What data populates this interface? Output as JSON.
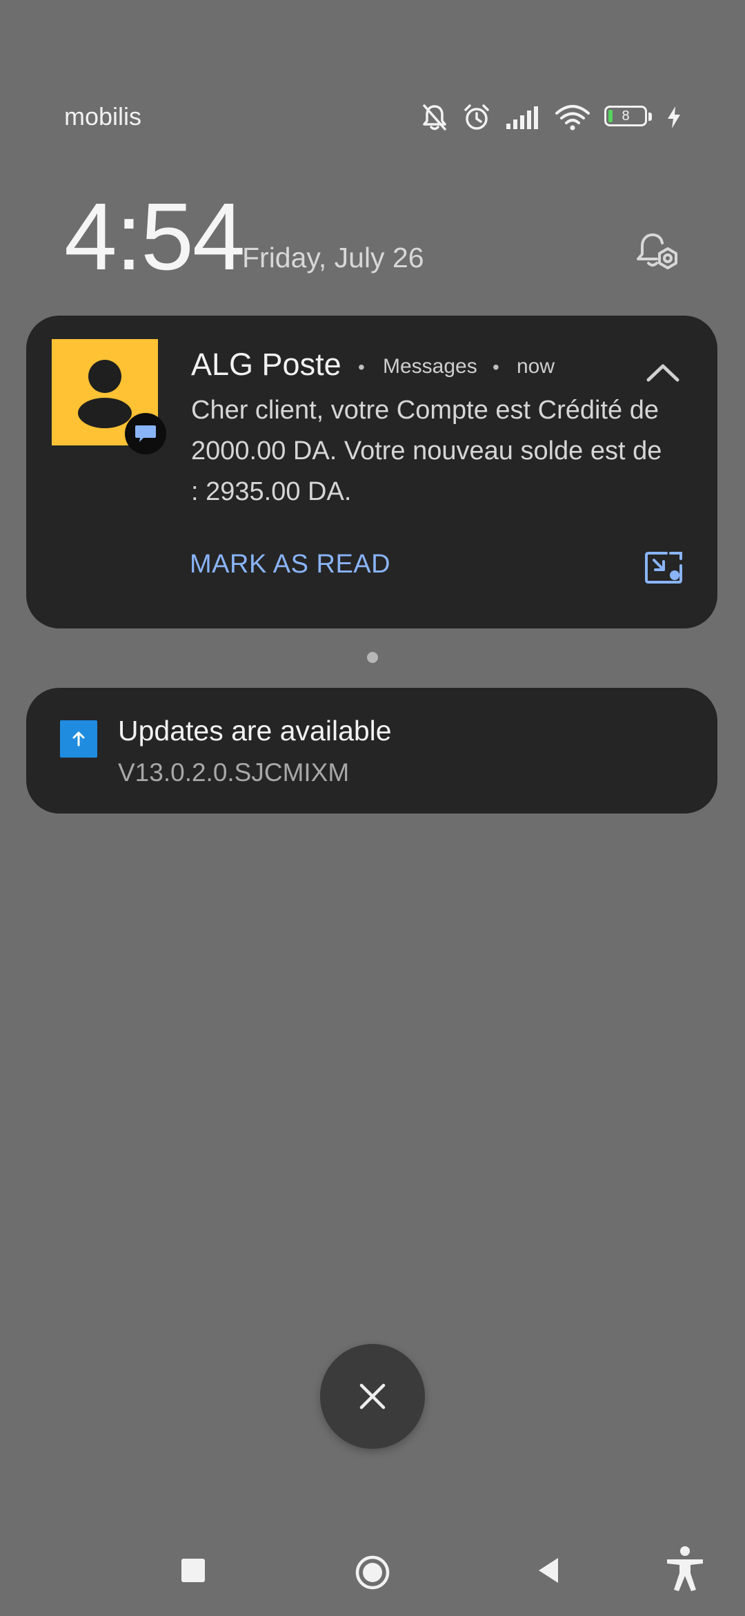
{
  "status_bar": {
    "carrier": "mobilis",
    "battery_level": "8",
    "icons": [
      "bell-muted-icon",
      "alarm-icon",
      "signal-icon",
      "wifi-icon",
      "battery-icon",
      "charging-bolt-icon"
    ]
  },
  "lockscreen": {
    "time": "4:54",
    "date": "Friday, July 26"
  },
  "notifications": [
    {
      "sender": "ALG Poste",
      "app": "Messages",
      "time": "now",
      "message": "Cher client, votre Compte est Crédité de 2000.00 DA. Votre nouveau solde est de : 2935.00 DA.",
      "action": "MARK AS READ",
      "avatar_color": "#fec234",
      "action_color": "#8ab4f8"
    },
    {
      "title": "Updates are available",
      "subtitle": "V13.0.2.0.SJCMIXM",
      "icon_color": "#1f8ce0"
    }
  ],
  "separator": "•",
  "colors": {
    "background": "#6e6e6e",
    "card": "#252525"
  }
}
